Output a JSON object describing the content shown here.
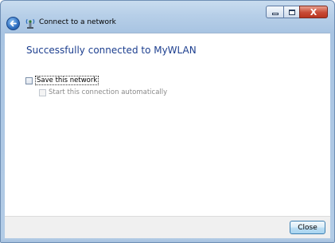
{
  "window": {
    "title": "Connect to a network",
    "close_caption": "X"
  },
  "content": {
    "headline": "Successfully connected to MyWLAN",
    "save_network_label": "Save this network",
    "start_automatically_label": "Start this connection automatically"
  },
  "footer": {
    "close_label": "Close"
  },
  "icons": {
    "back": "back-arrow-icon",
    "header": "network-icon"
  }
}
